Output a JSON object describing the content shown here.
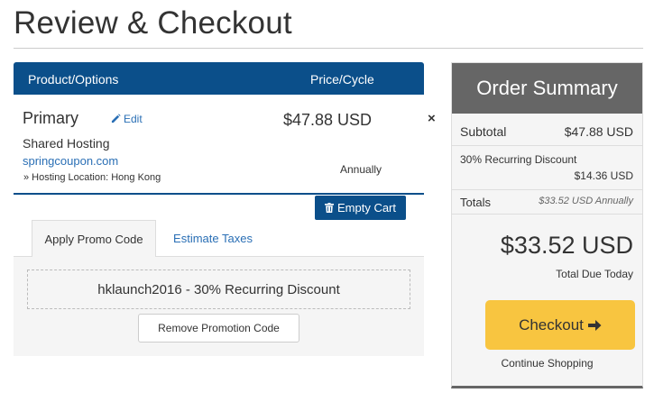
{
  "page": {
    "title": "Review & Checkout"
  },
  "cart": {
    "headers": {
      "product": "Product/Options",
      "price": "Price/Cycle"
    },
    "item": {
      "name": "Primary",
      "edit_label": "Edit",
      "type": "Shared Hosting",
      "domain": "springcoupon.com",
      "config": "» Hosting Location: Hong Kong",
      "price": "$47.88 USD",
      "cycle": "Annually",
      "remove_icon": "×"
    },
    "empty_cart_label": "Empty Cart"
  },
  "tabs": [
    {
      "label": "Apply Promo Code",
      "active": true
    },
    {
      "label": "Estimate Taxes",
      "active": false
    }
  ],
  "promo": {
    "code_text": "hklaunch2016 - 30% Recurring Discount",
    "remove_label": "Remove Promotion Code"
  },
  "summary": {
    "title": "Order Summary",
    "subtotal_label": "Subtotal",
    "subtotal_value": "$47.88 USD",
    "discount_label": "30% Recurring Discount",
    "discount_value": "$14.36 USD",
    "totals_label": "Totals",
    "totals_value": "$33.52 USD Annually",
    "total_due": "$33.52 USD",
    "total_due_label": "Total Due Today",
    "checkout_label": "Checkout",
    "continue_label": "Continue Shopping"
  },
  "colors": {
    "primary": "#0b4f8a",
    "summary_header": "#666666",
    "checkout": "#f8c540",
    "link": "#2a6fb5"
  },
  "icons": [
    "pencil-icon",
    "remove-icon",
    "trash-icon",
    "arrow-right-icon"
  ]
}
